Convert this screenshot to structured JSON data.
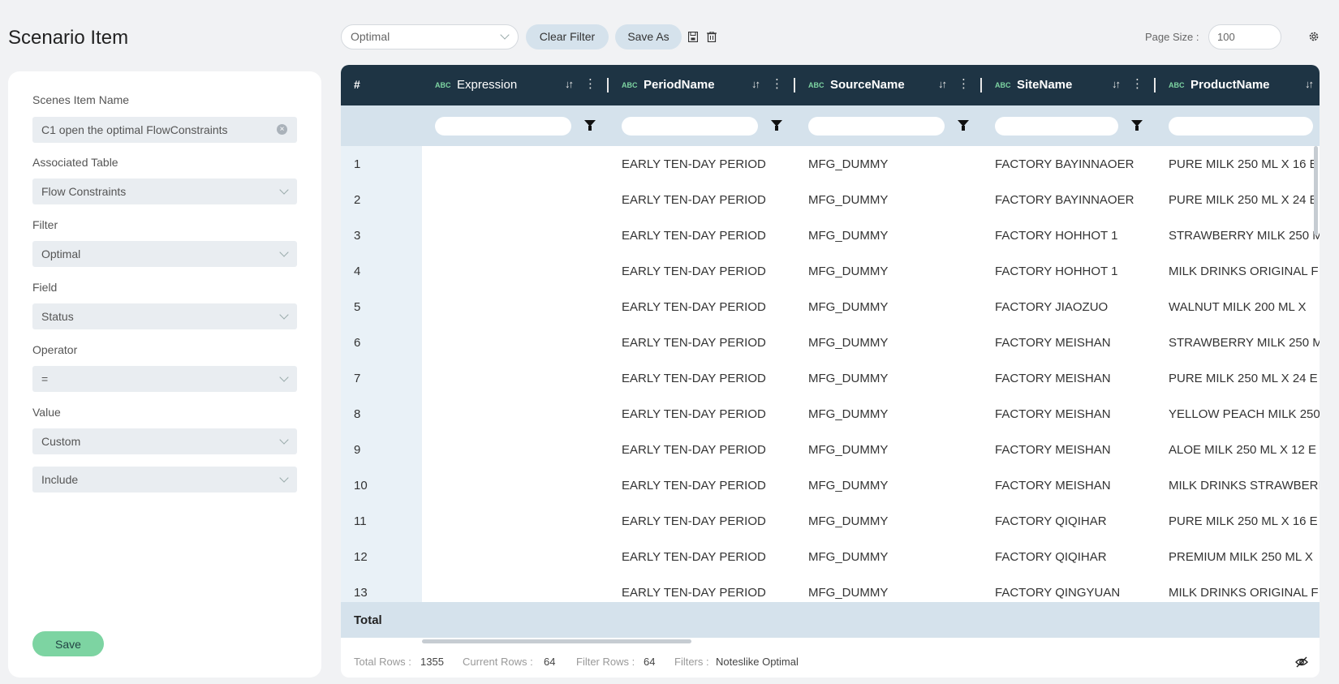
{
  "page_title": "Scenario Item",
  "form": {
    "scenes_item_name_label": "Scenes Item Name",
    "scenes_item_name_value": "C1 open the optimal FlowConstraints",
    "associated_table_label": "Associated Table",
    "associated_table_value": "Flow Constraints",
    "filter_label": "Filter",
    "filter_value": "Optimal",
    "field_label": "Field",
    "field_value": "Status",
    "operator_label": "Operator",
    "operator_value": "=",
    "value_label": "Value",
    "value_value": "Custom",
    "include_value": "Include",
    "save_label": "Save"
  },
  "toolbar": {
    "filter_select": "Optimal",
    "clear_filter_label": "Clear Filter",
    "save_as_label": "Save As",
    "page_size_label": "Page Size :",
    "page_size_value": "100",
    "icons": [
      "save-icon",
      "trash-icon",
      "gear-icon"
    ]
  },
  "grid": {
    "index_header": "#",
    "type_badge": "ABC",
    "columns": [
      "Expression",
      "PeriodName",
      "SourceName",
      "SiteName",
      "ProductName"
    ],
    "rows": [
      [
        "1",
        "",
        "EARLY TEN-DAY PERIOD",
        "MFG_DUMMY",
        "FACTORY BAYINNAOER",
        "PURE MILK 250 ML X 16 E"
      ],
      [
        "2",
        "",
        "EARLY TEN-DAY PERIOD",
        "MFG_DUMMY",
        "FACTORY BAYINNAOER",
        "PURE MILK 250 ML X 24 E"
      ],
      [
        "3",
        "",
        "EARLY TEN-DAY PERIOD",
        "MFG_DUMMY",
        "FACTORY HOHHOT 1",
        "STRAWBERRY MILK 250 M"
      ],
      [
        "4",
        "",
        "EARLY TEN-DAY PERIOD",
        "MFG_DUMMY",
        "FACTORY HOHHOT 1",
        "MILK DRINKS ORIGINAL F"
      ],
      [
        "5",
        "",
        "EARLY TEN-DAY PERIOD",
        "MFG_DUMMY",
        "FACTORY JIAOZUO",
        "WALNUT MILK 200 ML X"
      ],
      [
        "6",
        "",
        "EARLY TEN-DAY PERIOD",
        "MFG_DUMMY",
        "FACTORY MEISHAN",
        "STRAWBERRY MILK 250 M"
      ],
      [
        "7",
        "",
        "EARLY TEN-DAY PERIOD",
        "MFG_DUMMY",
        "FACTORY MEISHAN",
        "PURE MILK 250 ML X 24 E"
      ],
      [
        "8",
        "",
        "EARLY TEN-DAY PERIOD",
        "MFG_DUMMY",
        "FACTORY MEISHAN",
        "YELLOW PEACH MILK 250"
      ],
      [
        "9",
        "",
        "EARLY TEN-DAY PERIOD",
        "MFG_DUMMY",
        "FACTORY MEISHAN",
        "ALOE MILK 250 ML X 12 E"
      ],
      [
        "10",
        "",
        "EARLY TEN-DAY PERIOD",
        "MFG_DUMMY",
        "FACTORY MEISHAN",
        "MILK DRINKS STRAWBERI"
      ],
      [
        "11",
        "",
        "EARLY TEN-DAY PERIOD",
        "MFG_DUMMY",
        "FACTORY QIQIHAR",
        "PURE MILK 250 ML X 16 E"
      ],
      [
        "12",
        "",
        "EARLY TEN-DAY PERIOD",
        "MFG_DUMMY",
        "FACTORY QIQIHAR",
        "PREMIUM MILK 250 ML X"
      ],
      [
        "13",
        "",
        "EARLY TEN-DAY PERIOD",
        "MFG_DUMMY",
        "FACTORY QINGYUAN",
        "MILK DRINKS ORIGINAL F"
      ]
    ],
    "total_label": "Total"
  },
  "status": {
    "total_rows_label": "Total Rows :",
    "total_rows_value": "1355",
    "current_rows_label": "Current Rows :",
    "current_rows_value": "64",
    "filter_rows_label": "Filter Rows :",
    "filter_rows_value": "64",
    "filters_label": "Filters :",
    "filters_value": "Noteslike Optimal"
  },
  "colors": {
    "header_bg": "#1e3444",
    "filter_row_bg": "#d5e2ec",
    "accent_green": "#7dd4a2"
  }
}
